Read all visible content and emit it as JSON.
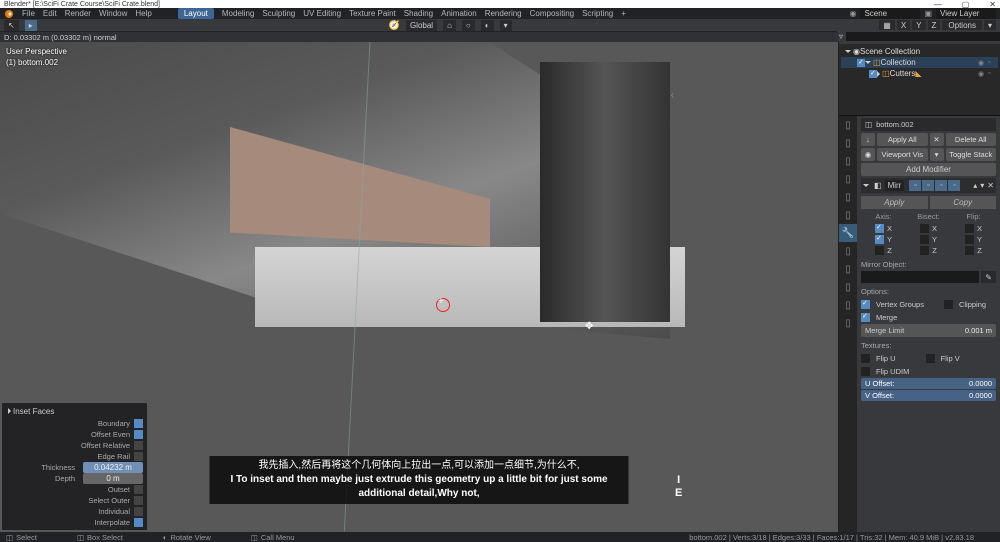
{
  "titlebar": {
    "title": "Blender* [E:\\SciFi Crate Course\\SciFi Crate.blend]",
    "minimize": "—",
    "maximize": "▢",
    "close": "✕"
  },
  "menu": {
    "items": [
      "File",
      "Edit",
      "Render",
      "Window",
      "Help"
    ],
    "workspaces": [
      "Layout",
      "Modeling",
      "Sculpting",
      "UV Editing",
      "Texture Paint",
      "Shading",
      "Animation",
      "Rendering",
      "Compositing",
      "Scripting"
    ],
    "active_workspace": "Layout",
    "plus": "+",
    "scene_label": "Scene",
    "viewlayer_label": "View Layer"
  },
  "toolbar": {
    "global": "Global",
    "options": "Options",
    "xyz": [
      "X",
      "Y",
      "Z"
    ]
  },
  "viewport": {
    "header": "D: 0.03302 m (0.03302 m) normal",
    "info1": "User Perspective",
    "info2": "(1) bottom.002",
    "ie": "I\nE",
    "move_glyph": "✥"
  },
  "subtitles": {
    "cn": "我先插入,然后再将这个几何体向上拉出一点,可以添加一点细节,为什么不,",
    "en": "I To inset and then maybe just extrude this geometry up a little bit for just some additional detail,Why not,"
  },
  "op_panel": {
    "title": "Inset Faces",
    "rows": [
      {
        "label": "Boundary",
        "check": true
      },
      {
        "label": "Offset Even",
        "check": true
      },
      {
        "label": "Offset Relative",
        "check": false
      },
      {
        "label": "Edge Rail",
        "check": false
      }
    ],
    "thickness_label": "Thickness",
    "thickness": "0.04232 m",
    "depth_label": "Depth",
    "depth": "0 m",
    "rows2": [
      {
        "label": "Outset",
        "check": false
      },
      {
        "label": "Select Outer",
        "check": false
      },
      {
        "label": "Individual",
        "check": false
      },
      {
        "label": "Interpolate",
        "check": true
      }
    ]
  },
  "outliner": {
    "scene_collection": "Scene Collection",
    "collection": "Collection",
    "cutters": "Cutters"
  },
  "props": {
    "breadcrumb_obj": "bottom.002",
    "apply_all": "Apply All",
    "delete_all": "Delete All",
    "viewport_vis": "Viewport Vis",
    "toggle_stack": "Toggle Stack",
    "add_modifier": "Add Modifier",
    "mod_name": "Mirr",
    "apply": "Apply",
    "copy": "Copy",
    "axis": "Axis:",
    "bisect": "Bisect:",
    "flip": "Flip:",
    "x": "X",
    "y": "Y",
    "z": "Z",
    "mirror_object": "Mirror Object:",
    "options": "Options:",
    "vertex_groups": "Vertex Groups",
    "clipping": "Clipping",
    "merge": "Merge",
    "merge_limit_label": "Merge Limit",
    "merge_limit": "0.001 m",
    "textures": "Textures:",
    "flip_u": "Flip U",
    "flip_v": "Flip V",
    "flip_udim": "Flip UDIM",
    "u_offset": "U Offset:",
    "v_offset": "V Offset:",
    "offset_val": "0.0000"
  },
  "status": {
    "select": "Select",
    "box": "Box Select",
    "rotate": "Rotate View",
    "call": "Call Menu",
    "right": "bottom.002 | Verts:3/18 | Edges:3/33 | Faces:1/17 | Tris:32 | Mem: 40.9 MiB | v2.83.18"
  },
  "chart_data": null
}
